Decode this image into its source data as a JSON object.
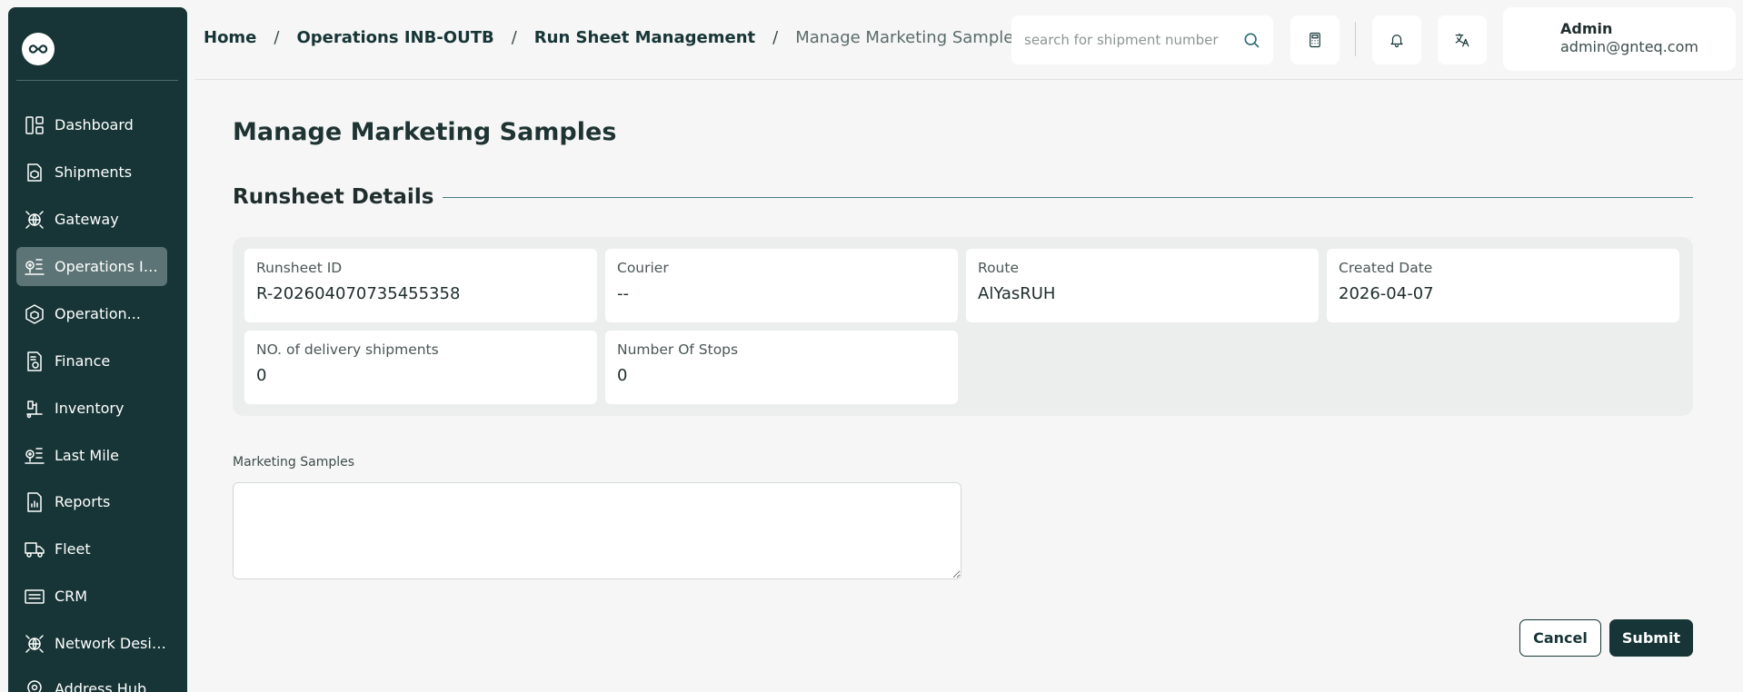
{
  "sidebar": {
    "logo_icon": "infinity-logo-icon",
    "items": [
      {
        "label": "Dashboard",
        "icon": "dashboard-icon",
        "active": false
      },
      {
        "label": "Shipments",
        "icon": "package-icon",
        "active": false
      },
      {
        "label": "Gateway",
        "icon": "globe-network-icon",
        "active": false
      },
      {
        "label": "Operations IN...",
        "icon": "route-pin-icon",
        "active": true
      },
      {
        "label": "Operation...",
        "icon": "warehouse-box-icon",
        "active": false
      },
      {
        "label": "Finance",
        "icon": "invoice-icon",
        "active": false
      },
      {
        "label": "Inventory",
        "icon": "forklift-icon",
        "active": false
      },
      {
        "label": "Last Mile",
        "icon": "route-pin-icon",
        "active": false
      },
      {
        "label": "Reports",
        "icon": "report-chart-icon",
        "active": false
      },
      {
        "label": "Fleet",
        "icon": "truck-icon",
        "active": false
      },
      {
        "label": "CRM",
        "icon": "crm-icon",
        "active": false
      },
      {
        "label": "Network Design",
        "icon": "globe-network-icon",
        "active": false
      },
      {
        "label": "Address Hub",
        "icon": "location-pin-icon",
        "active": false
      }
    ]
  },
  "header": {
    "breadcrumb": {
      "home": "Home",
      "level1": "Operations INB-OUTB",
      "level2": "Run Sheet Management",
      "current": "Manage Marketing Samples",
      "separator": "/"
    },
    "search": {
      "placeholder": "search for shipment number",
      "value": ""
    },
    "user": {
      "name": "Admin",
      "email": "admin@gnteq.com"
    }
  },
  "main": {
    "page_title": "Manage Marketing Samples",
    "section_title": "Runsheet Details",
    "details": [
      {
        "label": "Runsheet ID",
        "value": "R-202604070735455358"
      },
      {
        "label": "Courier",
        "value": "--"
      },
      {
        "label": "Route",
        "value": "AlYasRUH"
      },
      {
        "label": "Created Date",
        "value": "2026-04-07"
      },
      {
        "label": "NO. of delivery shipments",
        "value": "0"
      },
      {
        "label": "Number Of Stops",
        "value": "0"
      }
    ],
    "marketing_samples": {
      "label": "Marketing Samples",
      "value": ""
    },
    "actions": {
      "cancel": "Cancel",
      "submit": "Submit"
    }
  },
  "colors": {
    "sidebar_bg": "#173536",
    "active_item": "#5c7475",
    "accent_line": "#4a7a80",
    "page_bg": "#f5f6f5"
  }
}
